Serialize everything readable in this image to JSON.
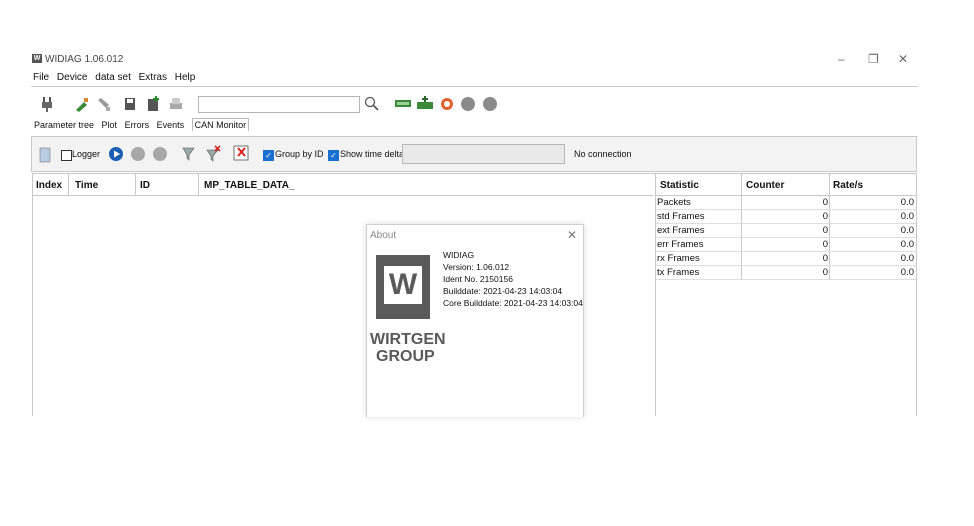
{
  "window": {
    "title": "WIDIAG 1.06.012",
    "app_icon_text": "W",
    "controls": {
      "minimize": "–",
      "restore": "❐",
      "close": "✕"
    }
  },
  "menu": [
    "File",
    "Device",
    "data set",
    "Extras",
    "Help"
  ],
  "toolbar": {
    "search_value": "",
    "search_icon": "magnifier-icon"
  },
  "tabs": [
    "Parameter tree",
    "Plot",
    "Errors",
    "Events",
    "CAN Monitor"
  ],
  "can_toolbar": {
    "logger_label": "Logger",
    "group_by_id_label": "Group by ID",
    "show_time_delta_label": "Show time delta",
    "connection_status": "No connection",
    "logger_checked": false,
    "group_by_id_checked": true,
    "show_time_delta_checked": true
  },
  "can_table": {
    "columns": [
      "Index",
      "Time",
      "ID",
      "MP_TABLE_DATA_"
    ]
  },
  "stats": {
    "columns": [
      "Statistic",
      "Counter",
      "Rate/s"
    ],
    "rows": [
      {
        "name": "Packets",
        "counter": "0",
        "rate": "0.0"
      },
      {
        "name": "std Frames",
        "counter": "0",
        "rate": "0.0"
      },
      {
        "name": "ext Frames",
        "counter": "0",
        "rate": "0.0"
      },
      {
        "name": "err Frames",
        "counter": "0",
        "rate": "0.0"
      },
      {
        "name": "rx Frames",
        "counter": "0",
        "rate": "0.0"
      },
      {
        "name": "tx Frames",
        "counter": "0",
        "rate": "0.0"
      }
    ]
  },
  "about": {
    "title": "About",
    "close": "✕",
    "logo_letter": "W",
    "logo_text_1": "WIRTGEN",
    "logo_text_2": "GROUP",
    "app_name": "WIDIAG",
    "version": "Version: 1.06.012",
    "ident": "Ident No. 2150156",
    "builddate": "Builddate: 2021-04-23 14:03:04",
    "core_builddate": "Core Builddate: 2021-04-23 14:03:04"
  },
  "colors": {
    "accent": "#1a6fd0",
    "logo_gray": "#5a5a5a",
    "toolbar_bg": "#f3f3f3"
  }
}
